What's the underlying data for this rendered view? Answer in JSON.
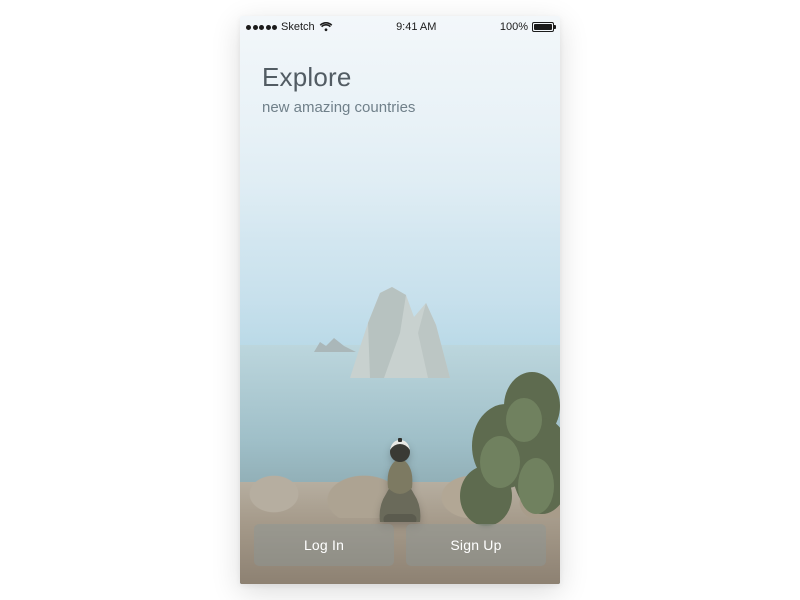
{
  "statusbar": {
    "carrier": "Sketch",
    "time": "9:41 AM",
    "battery_pct": "100%"
  },
  "headline": {
    "title": "Explore",
    "subtitle": "new amazing countries"
  },
  "actions": {
    "login": "Log In",
    "signup": "Sign Up"
  }
}
